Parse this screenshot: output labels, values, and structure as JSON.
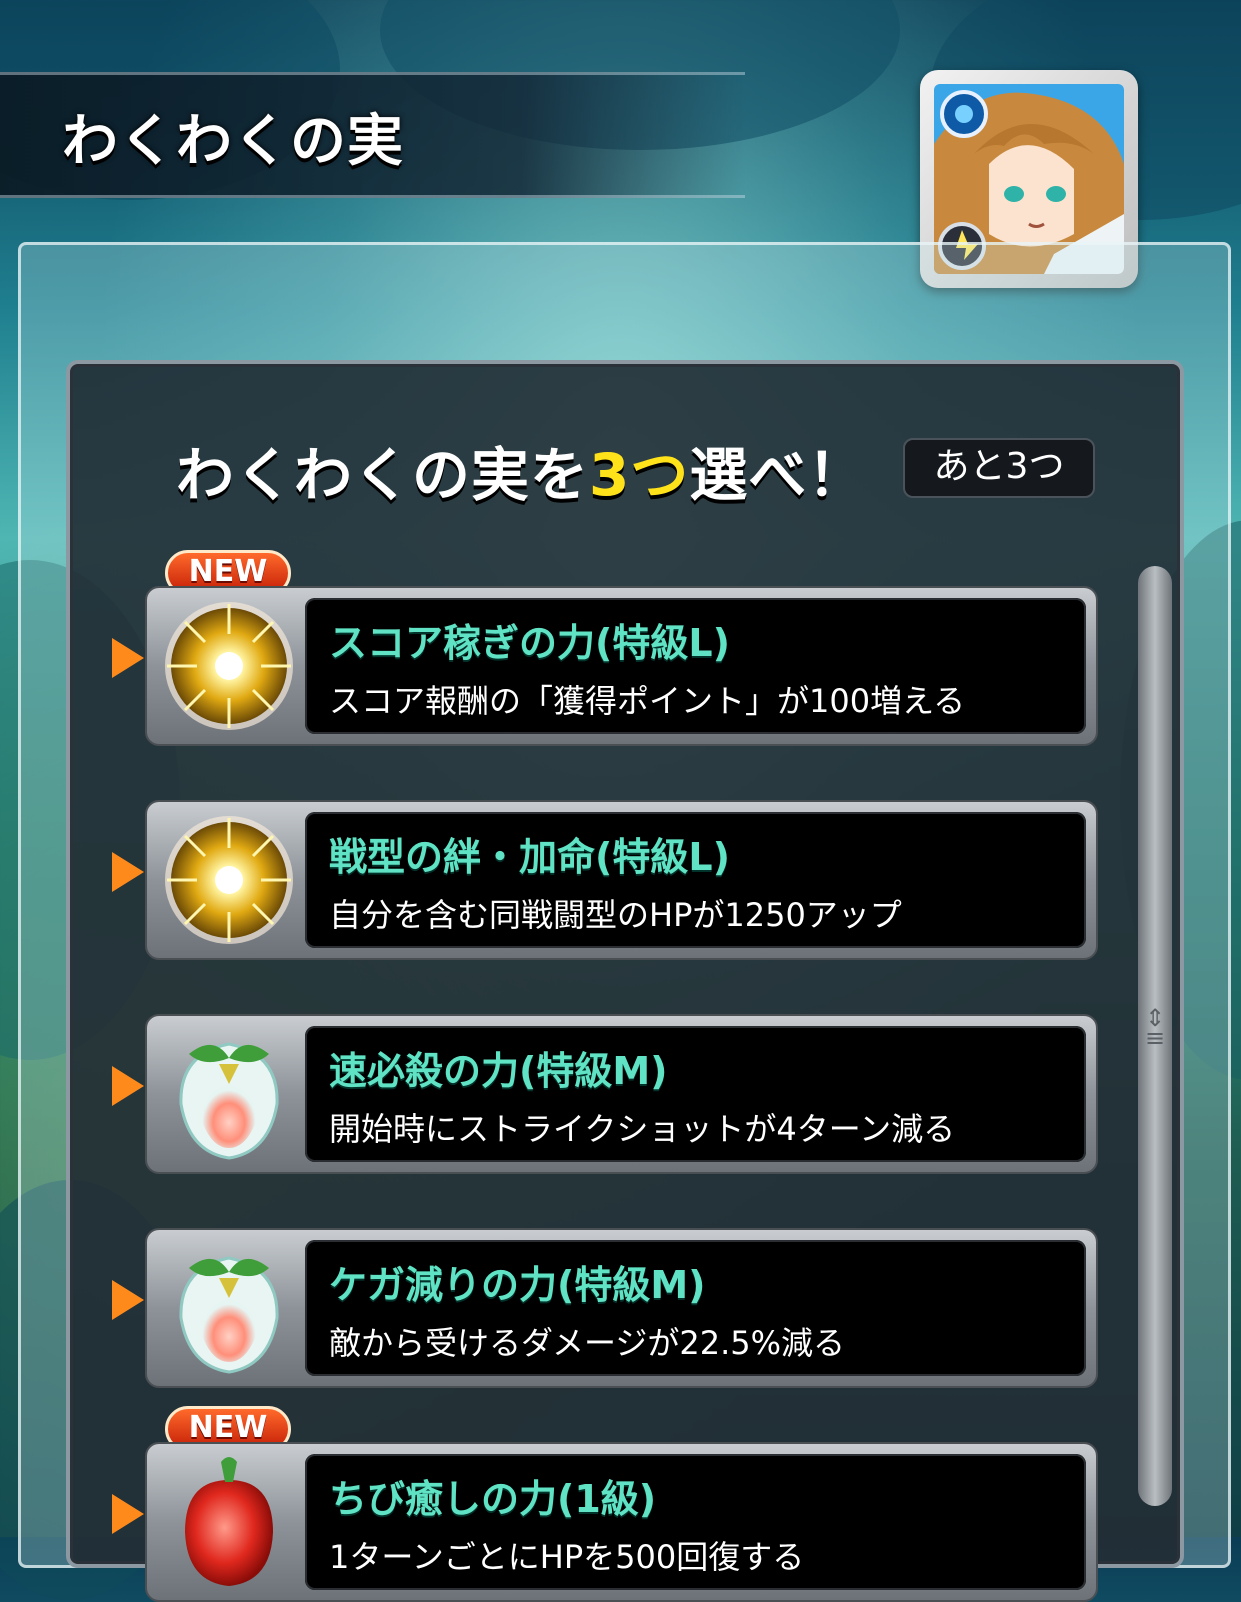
{
  "header": {
    "title": "わくわくの実"
  },
  "selection": {
    "prompt_before": "わくわくの実を",
    "prompt_count": "3つ",
    "prompt_after": "選べ！",
    "remaining_label": "あと3つ"
  },
  "fruits": [
    {
      "name": "スコア稼ぎの力(特級L)",
      "desc": "スコア報酬の「獲得ポイント」が100増える",
      "badge": "NEW",
      "icon": "gold-sun-fruit-icon"
    },
    {
      "name": "戦型の絆・加命(特級L)",
      "desc": "自分を含む同戦闘型のHPが1250アップ",
      "badge": "",
      "icon": "gold-sun-fruit-icon"
    },
    {
      "name": "速必殺の力(特級M)",
      "desc": "開始時にストライクショットが4ターン減る",
      "badge": "",
      "icon": "leaf-peach-fruit-icon"
    },
    {
      "name": "ケガ減りの力(特級M)",
      "desc": "敵から受けるダメージが22.5%減る",
      "badge": "",
      "icon": "leaf-peach-fruit-icon"
    },
    {
      "name": "ちび癒しの力(1級)",
      "desc": "1ターンごとにHPを500回復する",
      "badge": "NEW",
      "icon": "red-fruit-icon"
    }
  ],
  "colors": {
    "accent_yellow": "#ffe21a",
    "fruit_name": "#5fe3c4",
    "new_badge": "#e8380d",
    "arrow": "#ff8a1c"
  }
}
